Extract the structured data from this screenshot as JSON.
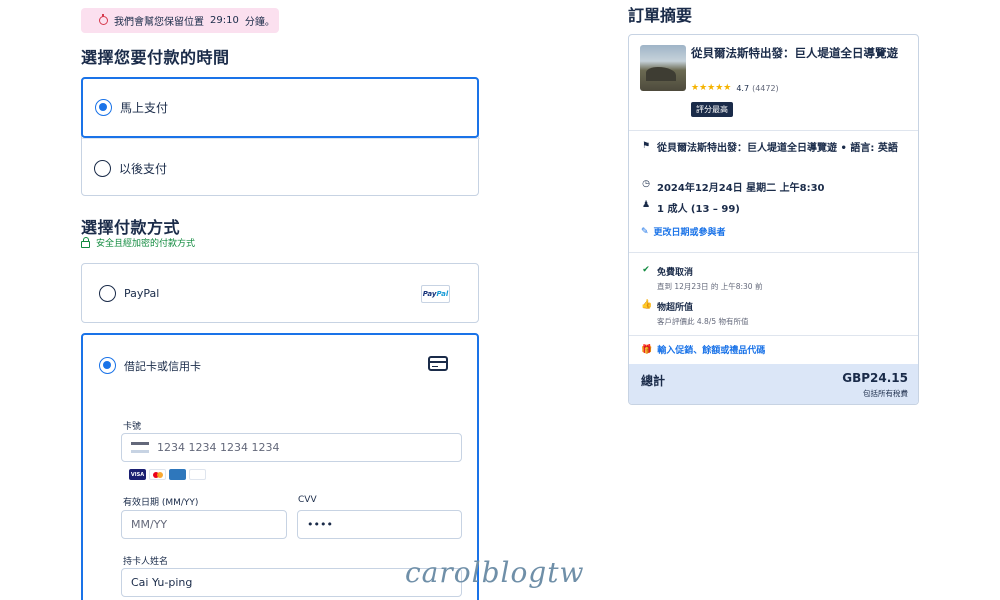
{
  "timer": {
    "text": "我們會幫您保留位置",
    "time": "29:10",
    "unit": "分鐘。"
  },
  "pay_time": {
    "title": "選擇您要付款的時間",
    "options": [
      {
        "label": "馬上支付",
        "selected": true
      },
      {
        "label": "以後支付",
        "selected": false
      }
    ]
  },
  "payment_method": {
    "title": "選擇付款方式",
    "secure_note": "安全且經加密的付款方式",
    "paypal": {
      "label": "PayPal",
      "logo_a": "Pay",
      "logo_b": "Pal"
    },
    "card": {
      "label": "借記卡或信用卡",
      "number_label": "卡號",
      "number_placeholder": "1234 1234 1234 1234",
      "brands": [
        "VISA",
        "MC",
        "AMEX",
        "JCB"
      ],
      "expiry_label": "有效日期 (MM/YY)",
      "expiry_placeholder": "MM/YY",
      "cvv_label": "CVV",
      "cvv_value": "••••",
      "holder_label": "持卡人姓名",
      "holder_value": "Cai Yu-ping"
    }
  },
  "watermark": "carolblogtw",
  "summary": {
    "title": "訂單摘要",
    "tour_title": "從貝爾法斯特出發：巨人堤道全日導覽遊",
    "rating": "4.7",
    "rating_stars": 4.7,
    "review_count": "(4472)",
    "badge": "評分最高",
    "detail_option": "從貝爾法斯特出發：巨人堤道全日導覽遊 • 語言: 英語",
    "date": "2024年12月24日 星期二 上午8:30",
    "participants": "1 成人 (13 – 99)",
    "edit_link": "更改日期或參與者",
    "free_cancel_title": "免費取消",
    "free_cancel_sub": "直到 12月23日 的 上午8:30 前",
    "value_title": "物超所值",
    "value_sub": "客戶評價此 4.8/5 物有所值",
    "promo_link": "輸入促銷、餘額或禮品代碼",
    "total_label": "總計",
    "total_amount": "GBP24.15",
    "tax_note": "包括所有稅費"
  },
  "colors": {
    "accent": "#1a73e8",
    "text": "#1a2b49",
    "success": "#108a3e",
    "banner": "#fbe0ef",
    "total_bg": "#dbe6f7"
  }
}
